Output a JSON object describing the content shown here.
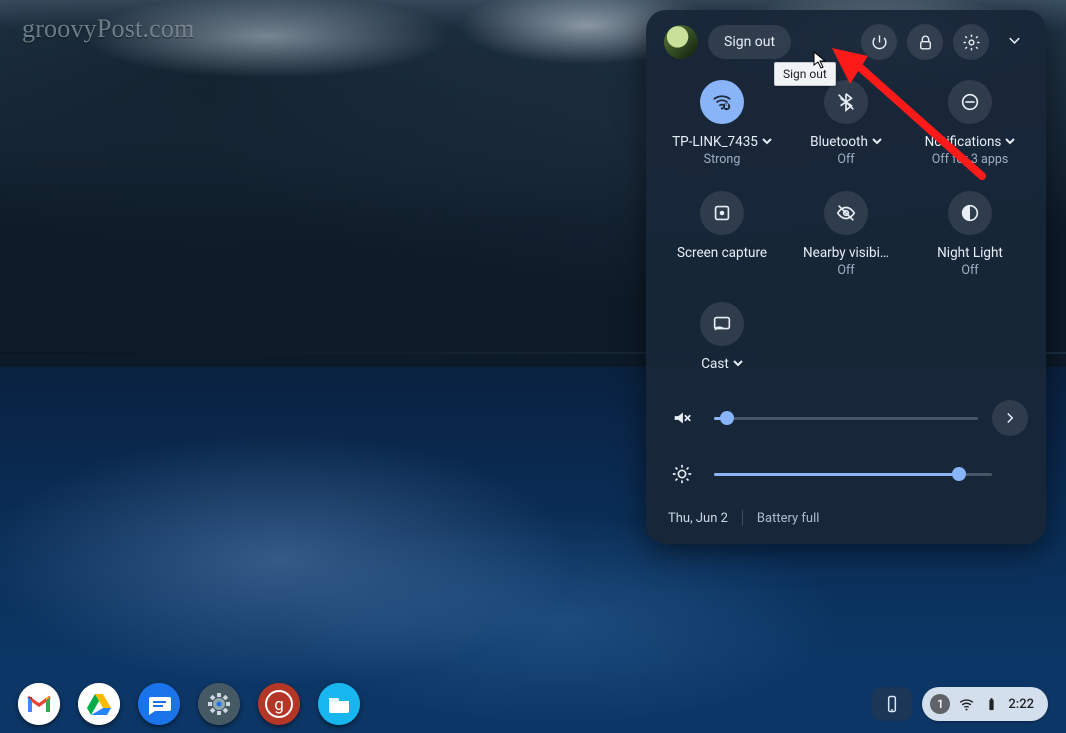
{
  "watermark": "groovyPost.com",
  "panel": {
    "sign_out_label": "Sign out",
    "tooltip": "Sign out",
    "tiles": {
      "wifi": {
        "label": "TP-LINK_7435",
        "sub": "Strong",
        "active": true,
        "has_menu": true
      },
      "bluetooth": {
        "label": "Bluetooth",
        "sub": "Off",
        "active": false,
        "has_menu": true
      },
      "notifications": {
        "label": "Notifications",
        "sub": "Off for 3 apps",
        "active": false,
        "has_menu": true
      },
      "screencap": {
        "label": "Screen capture",
        "sub": "",
        "active": false,
        "has_menu": false
      },
      "nearby": {
        "label": "Nearby visibi…",
        "sub": "Off",
        "active": false,
        "has_menu": false
      },
      "nightlight": {
        "label": "Night Light",
        "sub": "Off",
        "active": false,
        "has_menu": false
      },
      "cast": {
        "label": "Cast",
        "sub": "",
        "active": false,
        "has_menu": true
      }
    },
    "sliders": {
      "volume": {
        "percent": 5,
        "muted": true
      },
      "brightness": {
        "percent": 88
      }
    },
    "footer": {
      "date": "Thu, Jun 2",
      "battery": "Battery full"
    }
  },
  "shelf": {
    "status": {
      "notification_count": "1",
      "clock": "2:22"
    }
  }
}
